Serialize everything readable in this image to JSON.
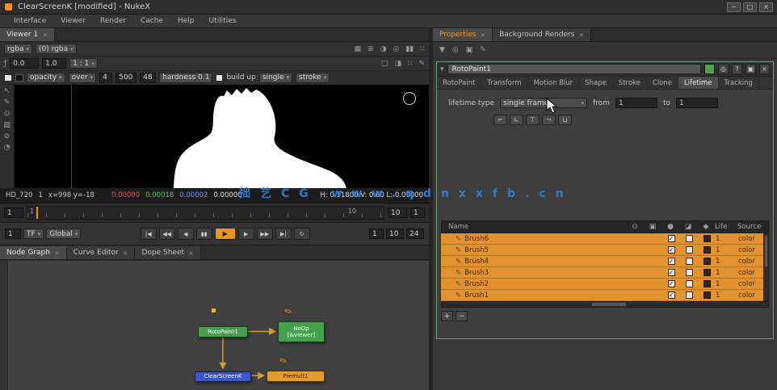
{
  "window": {
    "title": "ClearScreenK [modified] - NukeX",
    "minimize": "─",
    "maximize": "□",
    "close": "×"
  },
  "menu": {
    "items": [
      "Interface",
      "Viewer",
      "Render",
      "Cache",
      "Help",
      "Utilities"
    ]
  },
  "ui": {
    "caret": "▾",
    "close": "×"
  },
  "viewer": {
    "tab": "Viewer 1",
    "row1": {
      "channels": "rgba",
      "layer": "(0) rgba",
      "icons": [
        "▦",
        "≣",
        "◑",
        "◎",
        "▮▮",
        "∷"
      ]
    },
    "row2": {
      "gain_label": "ƒ",
      "gain": "0.0",
      "gamma": "1.0",
      "zoom": "1 : 1",
      "icons": [
        "□",
        "◨",
        "∷",
        "✎"
      ]
    },
    "paint": {
      "opacity": "opacity",
      "blend": "over",
      "size": "4",
      "spacing": "500",
      "angle": "48",
      "hardness": "hardness 0.1",
      "buildup": "build up",
      "lifetime": "single",
      "source": "stroke"
    },
    "tools": [
      "↖",
      "✎",
      "⊙",
      "▨",
      "⊘",
      "◔"
    ],
    "info": {
      "format": "HD_720",
      "frame": "1",
      "coords": "x=998  y=-18",
      "r": "0.00000",
      "g": "0.00018",
      "b": "0.00002",
      "a": "0.00000",
      "hvl": "H: 0.51800   V: 0.60   L: 0.00000"
    }
  },
  "timeline": {
    "current": "1",
    "tick_end": "10",
    "out": "10",
    "extra": "1"
  },
  "transport": {
    "frame": "1",
    "mode1": "TF",
    "mode2": "Global",
    "left_buttons": [
      "|◀",
      "◀◀",
      "◀",
      "▮▮"
    ],
    "play": "▶",
    "right_buttons": [
      "▶",
      "▶▶",
      "▶|",
      "↻"
    ],
    "in": "1",
    "out": "10",
    "fps": "24"
  },
  "node_graph": {
    "tabs": [
      "Node Graph",
      "Curve Editor",
      "Dope Sheet"
    ],
    "nodes": {
      "rotopaint": "RotoPaint1",
      "noop": "NoOp",
      "noop_sub": "[&viewer]",
      "keyer": "ClearScreenK",
      "premult": "Premult1"
    },
    "pen_marker": "✎"
  },
  "properties": {
    "tabs": [
      "Properties",
      "Background Renders"
    ],
    "toolbar_icons": [
      "▼",
      "◎",
      "▣",
      "✎"
    ],
    "panel": {
      "node_name": "RotoPaint1",
      "header_buttons": {
        "center": "◎",
        "help": "?",
        "float": "▣"
      },
      "tabs": [
        "RotoPaint",
        "Transform",
        "Motion Blur",
        "Shape",
        "Stroke",
        "Clone",
        "Lifetime",
        "Tracking"
      ],
      "lifetime": {
        "label": "lifetime type",
        "value": "single frame",
        "from_label": "from",
        "from": "1",
        "to_label": "to",
        "to": "1"
      },
      "range_buttons": [
        "⌐",
        "∟",
        "⊤",
        "¬",
        "⊔"
      ],
      "table": {
        "name_header": "Name",
        "icon_headers": [
          "⊙",
          "▣",
          "●",
          "◪",
          "◆"
        ],
        "life_header": "Life",
        "source_header": "Source",
        "row_icon": "✎",
        "check": "✓",
        "rows": [
          {
            "name": "Brush6",
            "life": "1",
            "source": "color"
          },
          {
            "name": "Brush5",
            "life": "1",
            "source": "color"
          },
          {
            "name": "Brush4",
            "life": "1",
            "source": "color"
          },
          {
            "name": "Brush3",
            "life": "1",
            "source": "color"
          },
          {
            "name": "Brush2",
            "life": "1",
            "source": "color"
          },
          {
            "name": "Brush1",
            "life": "1",
            "source": "color"
          }
        ],
        "add": "+",
        "remove": "−"
      }
    }
  },
  "watermark": "拙艺CG www.qdnxxfb.cn"
}
